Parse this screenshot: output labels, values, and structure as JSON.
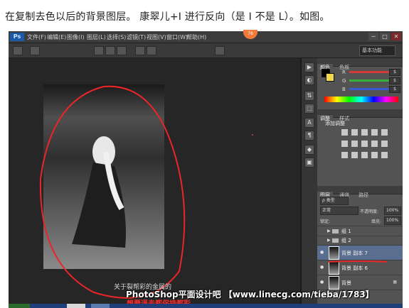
{
  "caption": "在复制去色以后的背景图层。 康翠儿+I 进行反向（是 I 不是 L）。如图。",
  "top_widget": "76",
  "menu": {
    "logo": "Ps",
    "items": [
      "文件(F)",
      "编辑(E)",
      "图像(I)",
      "图层(L)",
      "选择(S)",
      "滤镜(T)",
      "视图(V)",
      "窗口(W)",
      "帮助(H)"
    ]
  },
  "window_buttons": [
    "─",
    "□",
    "✕"
  ],
  "workspace": "基本功能",
  "tools_right": [
    "▶",
    "◐",
    "⇅",
    "⬚",
    "A",
    "¶",
    "◆",
    "▣"
  ],
  "panels": {
    "color_tabs": [
      "颜色",
      "色板"
    ],
    "channels": [
      "R",
      "G",
      "B"
    ],
    "channel_values": [
      "$",
      "$",
      "$"
    ],
    "colors": {
      "foreground": "#000000",
      "background": "#f2d84a",
      "red": "#d43a3a",
      "green": "#3ab03a",
      "blue": "#3a5ad4"
    },
    "adjust_tabs": [
      "调整",
      "样式"
    ],
    "adjust_label": "添加调整",
    "layers_tabs": [
      "图层",
      "通道",
      "路径"
    ],
    "kind_filter": "ρ 类型",
    "blend_mode": "正常",
    "opacity_label": "不透明度:",
    "opacity_value": "100%",
    "lock_label": "锁定:",
    "fill_label": "填充:",
    "fill_value": "100%",
    "layers": [
      {
        "name": "组 1",
        "type": "group",
        "visible": false
      },
      {
        "name": "组 2",
        "type": "group",
        "visible": false
      },
      {
        "name": "背景 副本 7",
        "type": "layer",
        "visible": true,
        "selected": true
      },
      {
        "name": "背景 副本 6",
        "type": "layer",
        "visible": true
      },
      {
        "name": "背景",
        "type": "background",
        "visible": true,
        "locked": true
      }
    ]
  },
  "canvas_annotation": "关于裂帮彩的金属的",
  "watermark": "PhotoShop平面设计吧 【www.linecg.com/tieba/1783】",
  "watermark_red": "想要退去都保持都彩",
  "annotations": {
    "highlight_color": "#e8262a"
  }
}
